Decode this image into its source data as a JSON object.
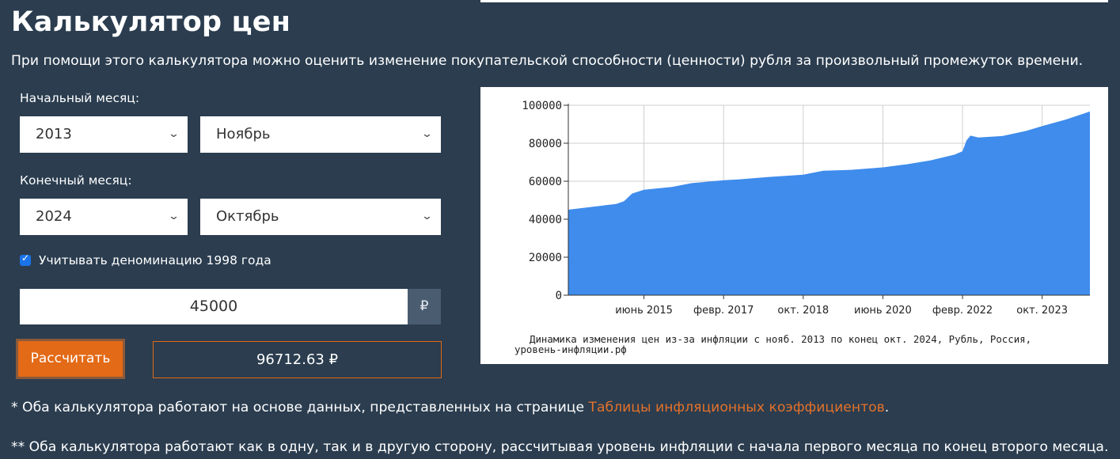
{
  "page": {
    "title": "Калькулятор цен",
    "description": "При помощи этого калькулятора можно оценить изменение покупательской способности (ценности) рубля за произвольный промежуток времени."
  },
  "form": {
    "start_label": "Начальный месяц:",
    "start_year": "2013",
    "start_month": "Ноябрь",
    "end_label": "Конечный месяц:",
    "end_year": "2024",
    "end_month": "Октябрь",
    "denomination_label": "Учитывать деноминацию 1998 года",
    "denomination_checked": true,
    "amount": "45000",
    "currency_symbol": "₽",
    "calculate_label": "Рассчитать",
    "result": "96712.63 ₽"
  },
  "notes": {
    "note1_prefix": "* Оба калькулятора работают на основе данных, представленных на странице ",
    "note1_link": "Таблицы инфляционных коэффициентов",
    "note1_suffix": ".",
    "note2": "** Оба калькулятора работают как в одну, так и в другую сторону, рассчитывая уровень инфляции с начала первого месяца по конец второго месяца."
  },
  "icons": {
    "dropdown": "chevron-down-icon",
    "checkbox": "checkmark-icon"
  },
  "colors": {
    "background": "#2b3d4f",
    "accent": "#e36a16",
    "link": "#e3712a",
    "chart_fill": "#3f8cec",
    "checkbox": "#1a73e8"
  },
  "chart_data": {
    "type": "area",
    "caption_line1": "Динамика изменения цен из-за инфляции с нояб. 2013 по конец окт. 2024, Рубль, Россия,",
    "caption_line2": "уровень-инфляции.рф",
    "y_ticks": [
      "0",
      "20000",
      "40000",
      "60000",
      "80000",
      "100000"
    ],
    "x_tick_labels": [
      "июнь 2015",
      "февр. 2017",
      "окт. 2018",
      "июнь 2020",
      "февр. 2022",
      "окт. 2023"
    ],
    "ylim": [
      0,
      100000
    ],
    "grid": true,
    "x": [
      "2013-11",
      "2014-06",
      "2014-11",
      "2015-01",
      "2015-03",
      "2015-06",
      "2016-01",
      "2016-06",
      "2017-02",
      "2017-06",
      "2018-01",
      "2018-10",
      "2019-03",
      "2019-10",
      "2020-06",
      "2020-12",
      "2021-06",
      "2021-12",
      "2022-02",
      "2022-03",
      "2022-04",
      "2022-06",
      "2022-12",
      "2023-06",
      "2023-10",
      "2024-04",
      "2024-10"
    ],
    "values": [
      45000,
      46800,
      48000,
      49500,
      53500,
      55500,
      57000,
      59000,
      60500,
      61000,
      62200,
      63400,
      65500,
      66000,
      67300,
      68900,
      71000,
      74000,
      75800,
      81500,
      84000,
      83000,
      83800,
      86500,
      89000,
      92500,
      96700
    ]
  }
}
